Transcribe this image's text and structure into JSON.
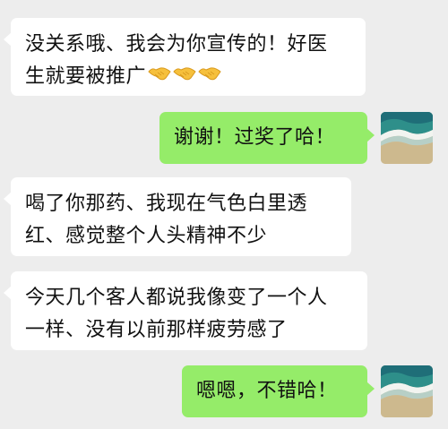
{
  "messages": [
    {
      "side": "in",
      "lines": [
        "没关系哦、我会为你宣传的！好医",
        "生就要被推广"
      ],
      "emoji": [
        "handshake",
        "handshake",
        "handshake"
      ]
    },
    {
      "side": "out",
      "lines": [
        "谢谢！过奖了哈！"
      ]
    },
    {
      "side": "in",
      "lines": [
        "喝了你那药、我现在气色白里透",
        "红、感觉整个人头精神不少"
      ]
    },
    {
      "side": "in",
      "lines": [
        "今天几个客人都说我像变了一个人",
        "一样、没有以前那样疲劳感了"
      ]
    },
    {
      "side": "out",
      "lines": [
        "嗯嗯，不错哈！"
      ]
    }
  ],
  "avatar": {
    "icon": "beach-waves-avatar-icon"
  },
  "colors": {
    "background": "#ededed",
    "incoming": "#ffffff",
    "outgoing": "#95ec69",
    "text": "#111111"
  }
}
